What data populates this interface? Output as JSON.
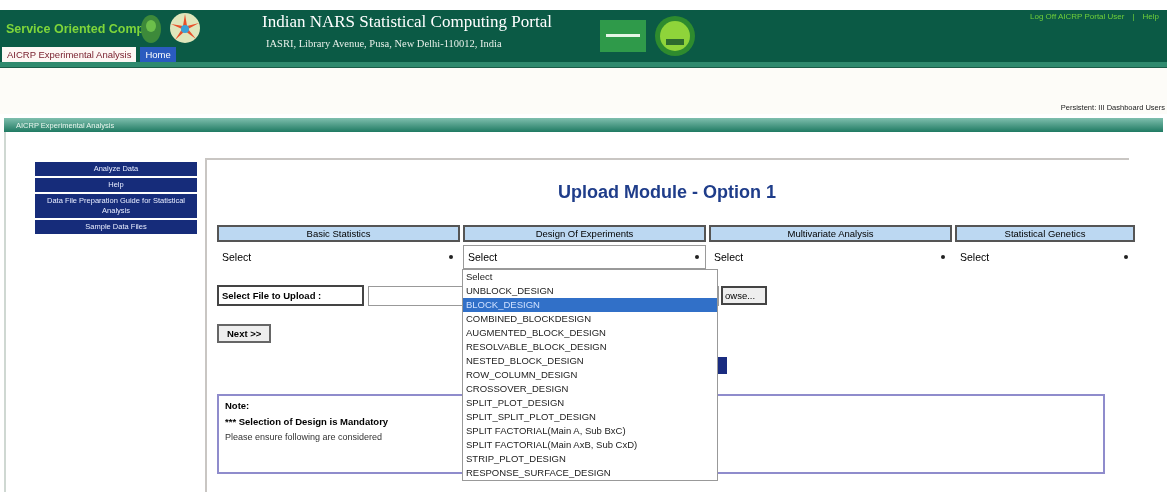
{
  "header": {
    "brand": "Service Oriented Comp",
    "title": "Indian NARS Statistical Computing Portal",
    "address": "IASRI, Library Avenue, Pusa, New Delhi-110012, India",
    "links": [
      "Log Off AICRP Portal User",
      "Help"
    ],
    "separator": "|"
  },
  "tabs": [
    {
      "label": "AICRP Experimental Analysis",
      "selected": false
    },
    {
      "label": "Home",
      "selected": true
    }
  ],
  "user_line": "Persistent: III Dashboard Users",
  "panel_title": "AICRP Experimental Analysis",
  "sidebar": {
    "items": [
      "Analyze Data",
      "Help",
      "Data File Preparation Guide for Statistical Analysis",
      "Sample Data Files"
    ]
  },
  "page_title": "Upload Module - Option 1",
  "categories": [
    {
      "heading": "Basic Statistics",
      "value": "Select",
      "expanded": false
    },
    {
      "heading": "Design Of Experiments",
      "value": "Select",
      "expanded": true
    },
    {
      "heading": "Multivariate Analysis",
      "value": "Select",
      "expanded": false
    },
    {
      "heading": "Statistical Genetics",
      "value": "Select",
      "expanded": false
    }
  ],
  "dropdown": {
    "options": [
      {
        "label": "Select",
        "selected": false
      },
      {
        "label": "UNBLOCK_DESIGN",
        "selected": false
      },
      {
        "label": "BLOCK_DESIGN",
        "selected": true
      },
      {
        "label": "COMBINED_BLOCKDESIGN",
        "selected": false
      },
      {
        "label": "AUGMENTED_BLOCK_DESIGN",
        "selected": false
      },
      {
        "label": "RESOLVABLE_BLOCK_DESIGN",
        "selected": false
      },
      {
        "label": "NESTED_BLOCK_DESIGN",
        "selected": false
      },
      {
        "label": "ROW_COLUMN_DESIGN",
        "selected": false
      },
      {
        "label": "CROSSOVER_DESIGN",
        "selected": false
      },
      {
        "label": "SPLIT_PLOT_DESIGN",
        "selected": false
      },
      {
        "label": "SPLIT_SPLIT_PLOT_DESIGN",
        "selected": false
      },
      {
        "label": "SPLIT FACTORIAL(Main A, Sub BxC)",
        "selected": false
      },
      {
        "label": "SPLIT FACTORIAL(Main AxB, Sub CxD)",
        "selected": false
      },
      {
        "label": "STRIP_PLOT_DESIGN",
        "selected": false
      },
      {
        "label": "RESPONSE_SURFACE_DESIGN",
        "selected": false
      }
    ]
  },
  "upload": {
    "label": "Select File to Upload :",
    "button": "owse..."
  },
  "next_button": "Next >>",
  "note": {
    "title": "Note:",
    "mandatory": "*** Selection of Design is Mandatory",
    "text": "Please ensure following are considered"
  }
}
